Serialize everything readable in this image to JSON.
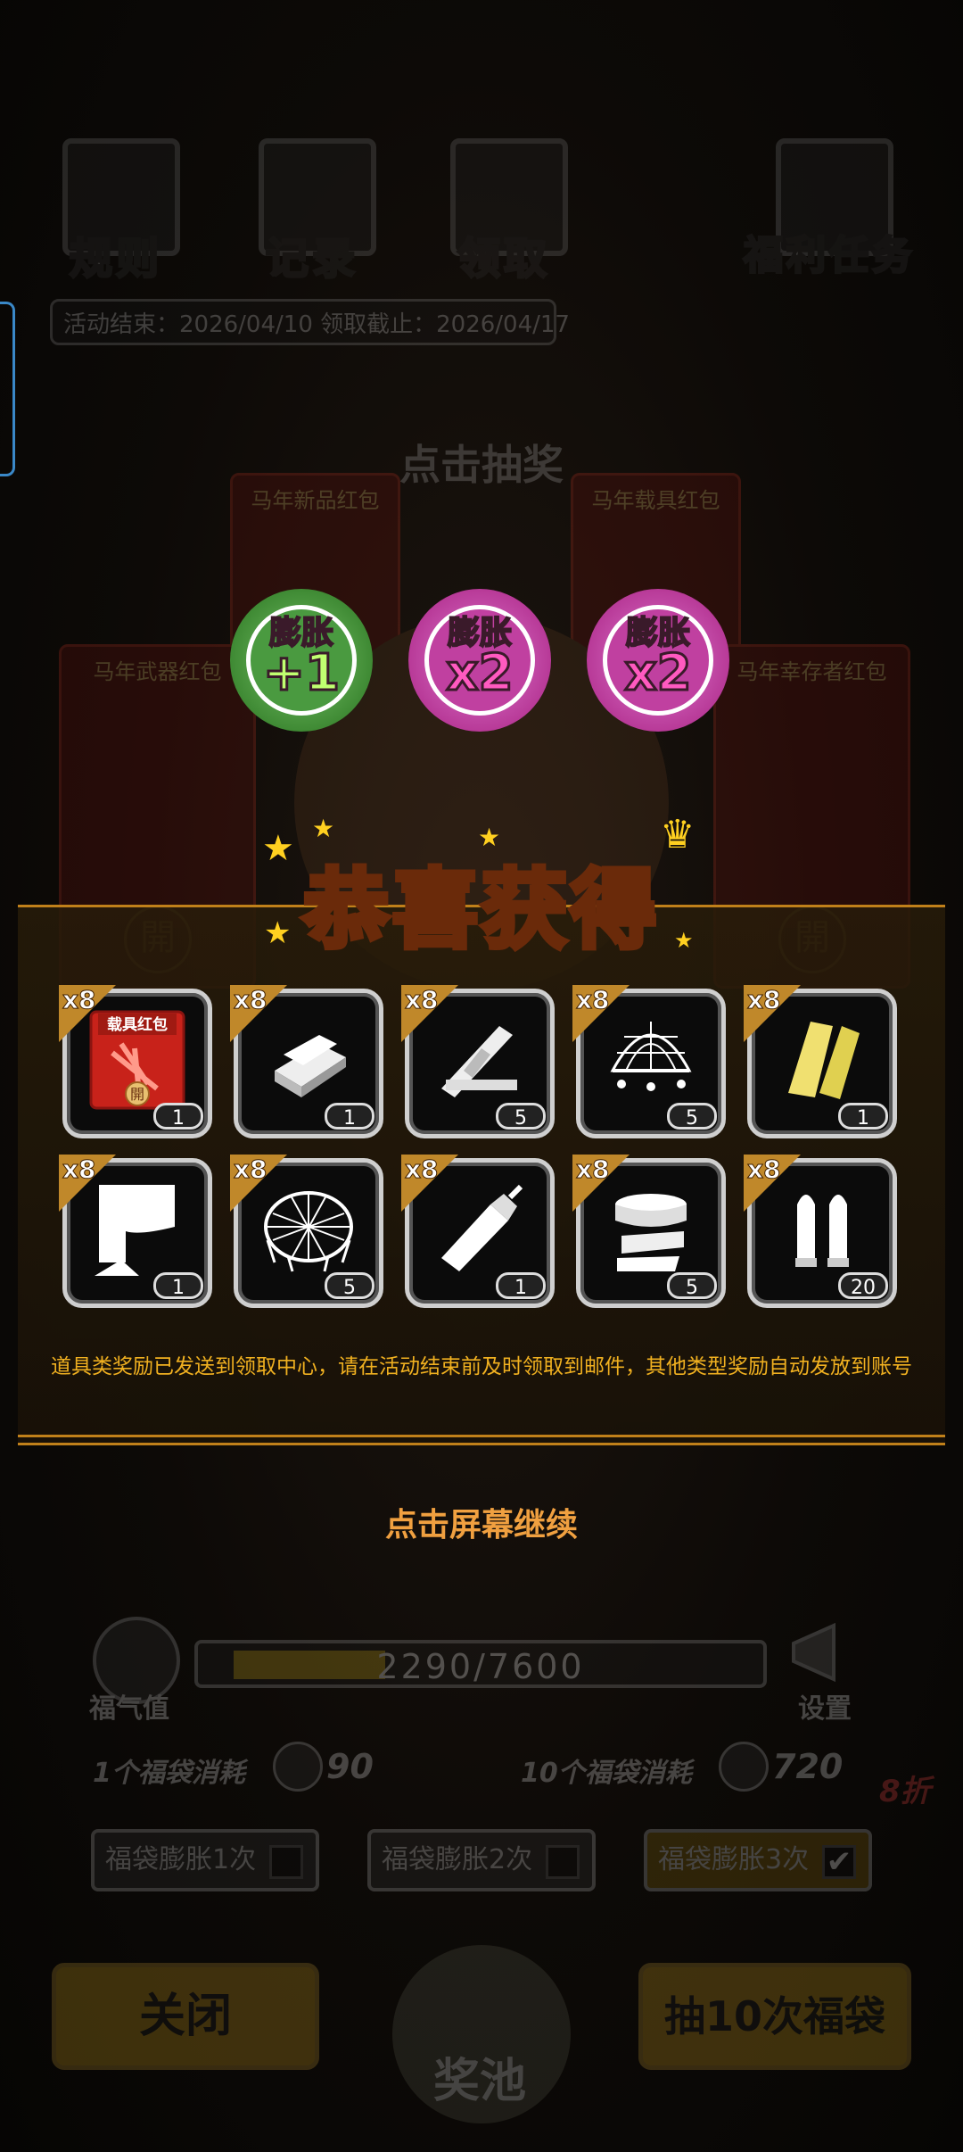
{
  "top_nav": [
    {
      "label": "规则",
      "icon": "rules-book-icon"
    },
    {
      "label": "记录",
      "icon": "record-clipboard-icon"
    },
    {
      "label": "领取",
      "icon": "claim-box-icon"
    },
    {
      "label": "福利任务",
      "icon": "welfare-task-icon"
    }
  ],
  "event_dates": "活动结束：2026/04/10  领取截止：2026/04/17",
  "click_draw": "点击抽奖",
  "envelopes": [
    "马年新品红包",
    "马年载具红包",
    "马年武器红包",
    "马年幸存者红包"
  ],
  "badges": [
    {
      "top": "膨胀",
      "value": "+1",
      "color": "#3f9a3a"
    },
    {
      "top": "膨胀",
      "value": "x2",
      "color": "#c43aa0"
    },
    {
      "top": "膨胀",
      "value": "x2",
      "color": "#c43aa0"
    }
  ],
  "congrats_title": "恭喜获得",
  "items": [
    {
      "icon": "vehicle-red-envelope-icon",
      "mult": "x8",
      "count": "1",
      "envelope_label": "载具红包"
    },
    {
      "icon": "metal-ingot-icon",
      "mult": "x8",
      "count": "1"
    },
    {
      "icon": "wood-planks-icon",
      "mult": "x8",
      "count": "5"
    },
    {
      "icon": "net-trap-icon",
      "mult": "x8",
      "count": "5"
    },
    {
      "icon": "gold-planks-icon",
      "mult": "x8",
      "count": "1"
    },
    {
      "icon": "cloth-fabric-icon",
      "mult": "x8",
      "count": "1"
    },
    {
      "icon": "mesh-net-icon",
      "mult": "x8",
      "count": "5"
    },
    {
      "icon": "glue-tube-icon",
      "mult": "x8",
      "count": "1"
    },
    {
      "icon": "bandage-roll-icon",
      "mult": "x8",
      "count": "5"
    },
    {
      "icon": "bullets-icon",
      "mult": "x8",
      "count": "20"
    }
  ],
  "notice": "道具类奖励已发送到领取中心，请在活动结束前及时领取到邮件，其他类型奖励自动发放到账号",
  "continue_text": "点击屏幕继续",
  "fortune": {
    "label": "福气值",
    "progress_text": "2290/7600",
    "progress": 0.302
  },
  "settings_label": "设置",
  "cost_one": {
    "label": "1个福袋消耗",
    "value": "90"
  },
  "cost_ten": {
    "label": "10个福袋消耗",
    "value": "720",
    "discount": "8折"
  },
  "expand_options": [
    {
      "label": "福袋膨胀1次",
      "checked": false
    },
    {
      "label": "福袋膨胀2次",
      "checked": false
    },
    {
      "label": "福袋膨胀3次",
      "checked": true
    }
  ],
  "close_button": "关闭",
  "prize_pool": "奖池",
  "draw_ten_button": "抽10次福袋",
  "open_char": "開"
}
